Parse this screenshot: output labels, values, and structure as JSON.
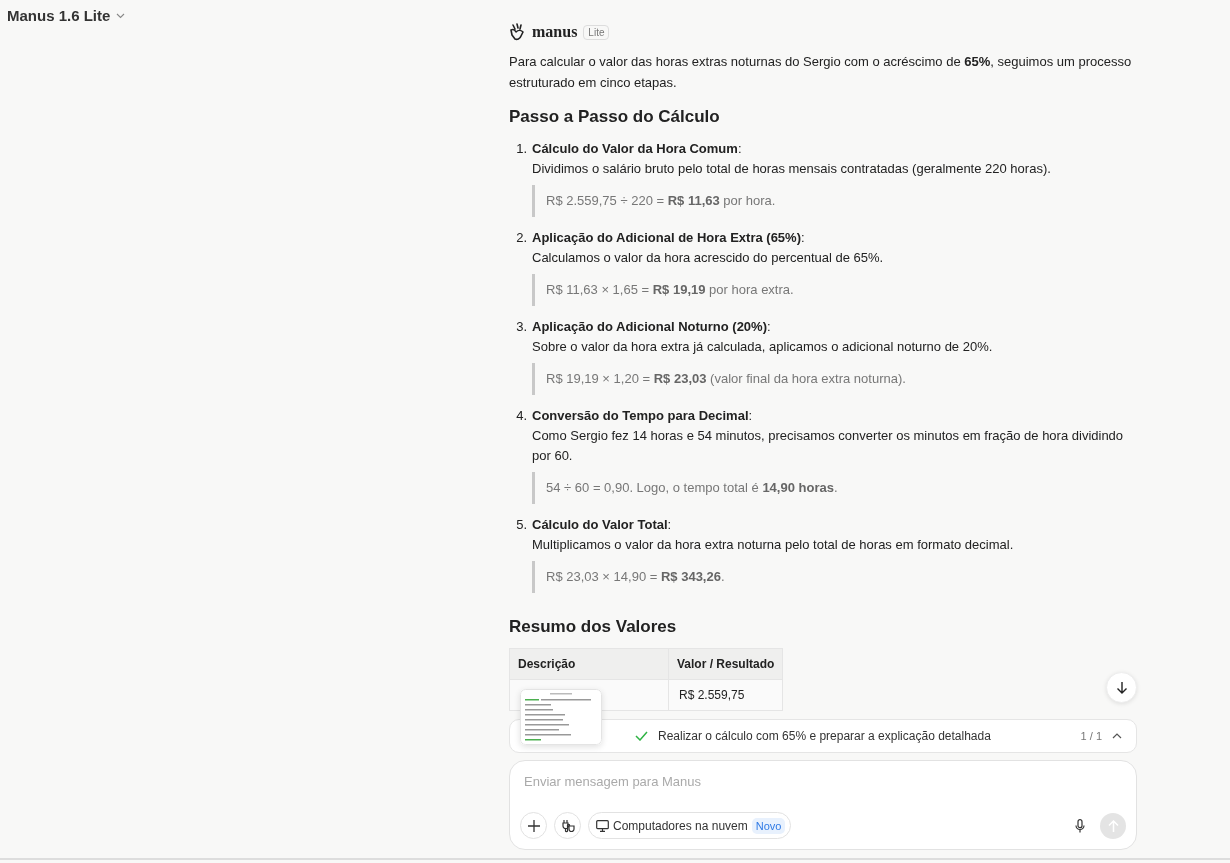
{
  "model_selector": {
    "label": "Manus 1.6 Lite"
  },
  "message": {
    "brand": "manus",
    "badge": "Lite",
    "intro": "Para calcular o valor das horas extras noturnas do Sergio com o acréscimo de **65%**, seguimos um processo estruturado em cinco etapas.",
    "heading": "Passo a Passo do Cálculo",
    "steps": [
      {
        "number": "1.",
        "title": "**Cálculo do Valor da Hora Comum**:",
        "text": "Dividimos o salário bruto pelo total de horas mensais contratadas (geralmente 220 horas).",
        "quote": "R$ 2.559,75 ÷ 220 = **R$ 11,63** por hora."
      },
      {
        "number": "2.",
        "title": "**Aplicação do Adicional de Hora Extra (65%)**:",
        "text": "Calculamos o valor da hora acrescido do percentual de 65%.",
        "quote": "R$ 11,63 × 1,65 = **R$ 19,19** por hora extra."
      },
      {
        "number": "3.",
        "title": "**Aplicação do Adicional Noturno (20%)**:",
        "text": "Sobre o valor da hora extra já calculada, aplicamos o adicional noturno de 20%.",
        "quote": "R$ 19,19 × 1,20 = **R$ 23,03** (valor final da hora extra noturna)."
      },
      {
        "number": "4.",
        "title": "**Conversão do Tempo para Decimal**:",
        "text": "Como Sergio fez 14 horas e 54 minutos, precisamos converter os minutos em fração de hora dividindo por 60.",
        "quote": "54 ÷ 60 = 0,90. Logo, o tempo total é **14,90 horas**."
      },
      {
        "number": "5.",
        "title": "**Cálculo do Valor Total**:",
        "text": "Multiplicamos o valor da hora extra noturna pelo total de horas em formato decimal.",
        "quote": "R$ 23,03 × 14,90 = **R$ 343,26**."
      }
    ],
    "summary_heading": "Resumo dos Valores",
    "table": {
      "columns": [
        "Descrição",
        "Valor / Resultado"
      ],
      "rows": [
        [
          "",
          "R$ 2.559,75"
        ]
      ]
    }
  },
  "task_bar": {
    "done": true,
    "text": "Realizar o cálculo com 65% e preparar a explicação detalhada",
    "counter": "1 / 1"
  },
  "composer": {
    "placeholder": "Enviar mensagem para Manus",
    "chip": "Computadores na nuvem",
    "chip_badge": "Novo"
  }
}
